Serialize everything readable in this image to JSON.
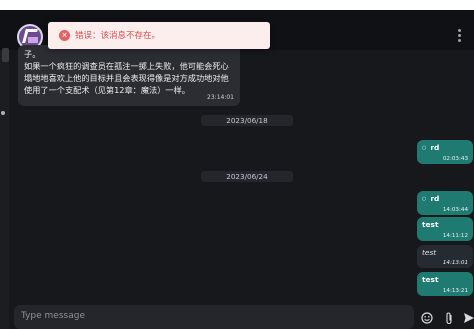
{
  "toast": {
    "text": "错误：该消息不存在。",
    "icon": "error-x-icon"
  },
  "incoming": {
    "lines": [
      "子。",
      "如果一个疯狂的调查员在孤注一掷上失败，他可能会死心",
      "塌地地喜欢上他的目标并且会表现得像是对方成功地对他",
      "使用了一个支配术（见第12章：魔法）一样。"
    ],
    "time": "23:14:01"
  },
  "dates": [
    "2023/06/18",
    "2023/06/24"
  ],
  "outgoing": [
    {
      "text": "rd",
      "time": "02:03:43",
      "style": "teal"
    },
    {
      "text": "rd",
      "time": "14:03:44",
      "style": "teal"
    },
    {
      "text": "test",
      "time": "14:11:12",
      "style": "teal"
    },
    {
      "text": "test",
      "time": "14:13:01",
      "style": "dark"
    },
    {
      "text": "test",
      "time": "14:13:21",
      "style": "teal"
    }
  ],
  "composer": {
    "placeholder": "Type message"
  },
  "icons": {
    "emoji": "emoji-icon",
    "attach": "paperclip-icon",
    "send": "send-icon",
    "menu": "more-vertical-icon"
  },
  "colors": {
    "accent": "#1f7a72",
    "background": "#17181c",
    "toast_bg": "#fdeeee",
    "toast_text": "#d35050"
  }
}
